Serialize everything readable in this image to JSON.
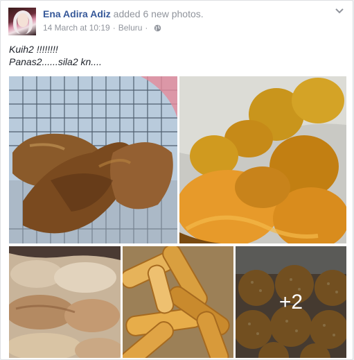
{
  "post": {
    "author": "Ena Adira Adiz",
    "action": "added 6 new photos.",
    "date": "14 March at 10:19",
    "location": "Beluru",
    "privacy_icon": "globe-icon",
    "menu_icon": "chevron-down-icon",
    "caption_line1": "Kuih2 !!!!!!!!",
    "caption_line2": "Panas2......sila2 kn...."
  },
  "photos": {
    "more_count_label": "+2"
  },
  "colors": {
    "author_link": "#365899",
    "meta_text": "#90949c",
    "body_text": "#1d2129"
  }
}
